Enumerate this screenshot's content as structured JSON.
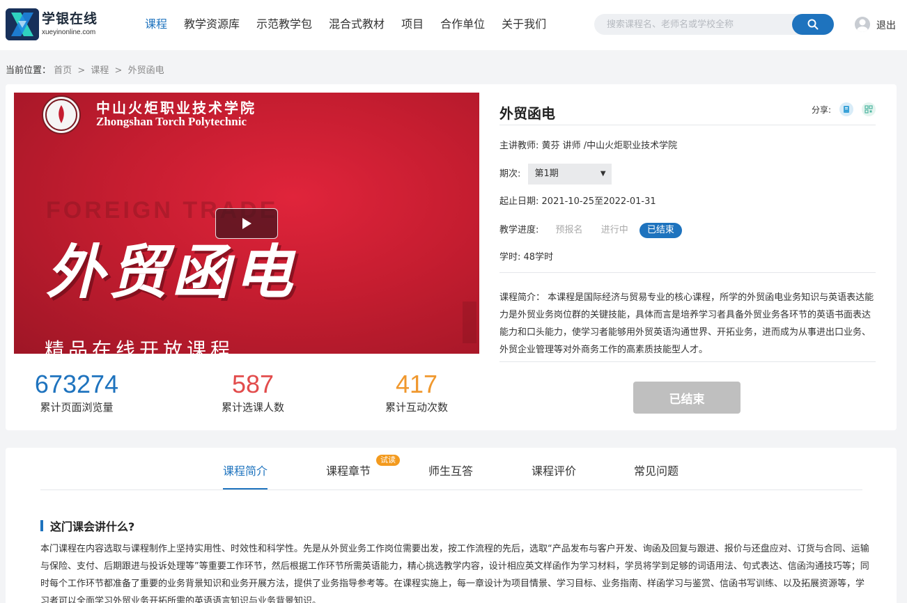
{
  "header": {
    "logo_title": "学银在线",
    "logo_sub": "xueyinonline.com",
    "nav": [
      "课程",
      "教学资源库",
      "示范教学包",
      "混合式教材",
      "项目",
      "合作单位",
      "关于我们"
    ],
    "search_placeholder": "搜索课程名、老师名或学校全称",
    "logout": "退出"
  },
  "breadcrumb": {
    "prefix": "当前位置：",
    "items": [
      "首页",
      "课程",
      "外贸函电"
    ],
    "separator": ">"
  },
  "video": {
    "school_cn": "中山火炬职业技术学院",
    "school_en": "Zhongshan Torch Polytechnic",
    "bg_en": "FOREIGN TRADE",
    "big_title": "外贸函电",
    "subtitle": "精品在线开放课程"
  },
  "stats": [
    {
      "value": "673274",
      "label": "累计页面浏览量",
      "color": "#1e73be"
    },
    {
      "value": "587",
      "label": "累计选课人数",
      "color": "#e24c4c"
    },
    {
      "value": "417",
      "label": "累计互动次数",
      "color": "#f0982e"
    }
  ],
  "course": {
    "title": "外贸函电",
    "share_label": "分享:",
    "teacher_label": "主讲教师:",
    "teacher_value": "黄芬 讲师 /中山火炬职业技术学院",
    "term_label": "期次:",
    "term_value": "第1期",
    "date_label": "起止日期:",
    "date_value": "2021-10-25至2022-01-31",
    "progress_label": "教学进度:",
    "progress_steps": [
      "预报名",
      "进行中",
      "已结束"
    ],
    "hours_label": "学时:",
    "hours_value": "48学时",
    "intro_label": "课程简介：",
    "intro_text": "本课程是国际经济与贸易专业的核心课程，所学的外贸函电业务知识与英语表达能力是外贸业务岗位群的关键技能，具体而言是培养学习者具备外贸业务各环节的英语书面表达能力和口头能力，使学习者能够用外贸英语沟通世界、开拓业务，进而成为从事进出口业务、外贸企业管理等对外商务工作的高素质技能型人才。",
    "status_button": "已结束"
  },
  "tabs": {
    "items": [
      "课程简介",
      "课程章节",
      "师生互答",
      "课程评价",
      "常见问题"
    ],
    "trial_badge": "试读"
  },
  "section": {
    "heading": "这门课会讲什么?",
    "text": "本门课程在内容选取与课程制作上坚持实用性、时效性和科学性。先是从外贸业务工作岗位需要出发，按工作流程的先后，选取“产品发布与客户开发、询函及回复与跟进、报价与还盘应对、订货与合同、运输与保险、支付、后期跟进与投诉处理等”等重要工作环节，然后根据工作环节所需英语能力，精心挑选教学内容，设计相应英文样函作为学习材料，学员将学到足够的词语用法、句式表达、信函沟通技巧等；同时每个工作环节都准备了重要的业务背景知识和业务开展方法，提供了业务指导参考等。在课程实施上，每一章设计为项目情景、学习目标、业务指南、样函学习与鉴赏、信函书写训练、以及拓展资源等，学习者可以全面学习外贸业务开拓所需的英语语言知识与业务背景知识。"
  }
}
